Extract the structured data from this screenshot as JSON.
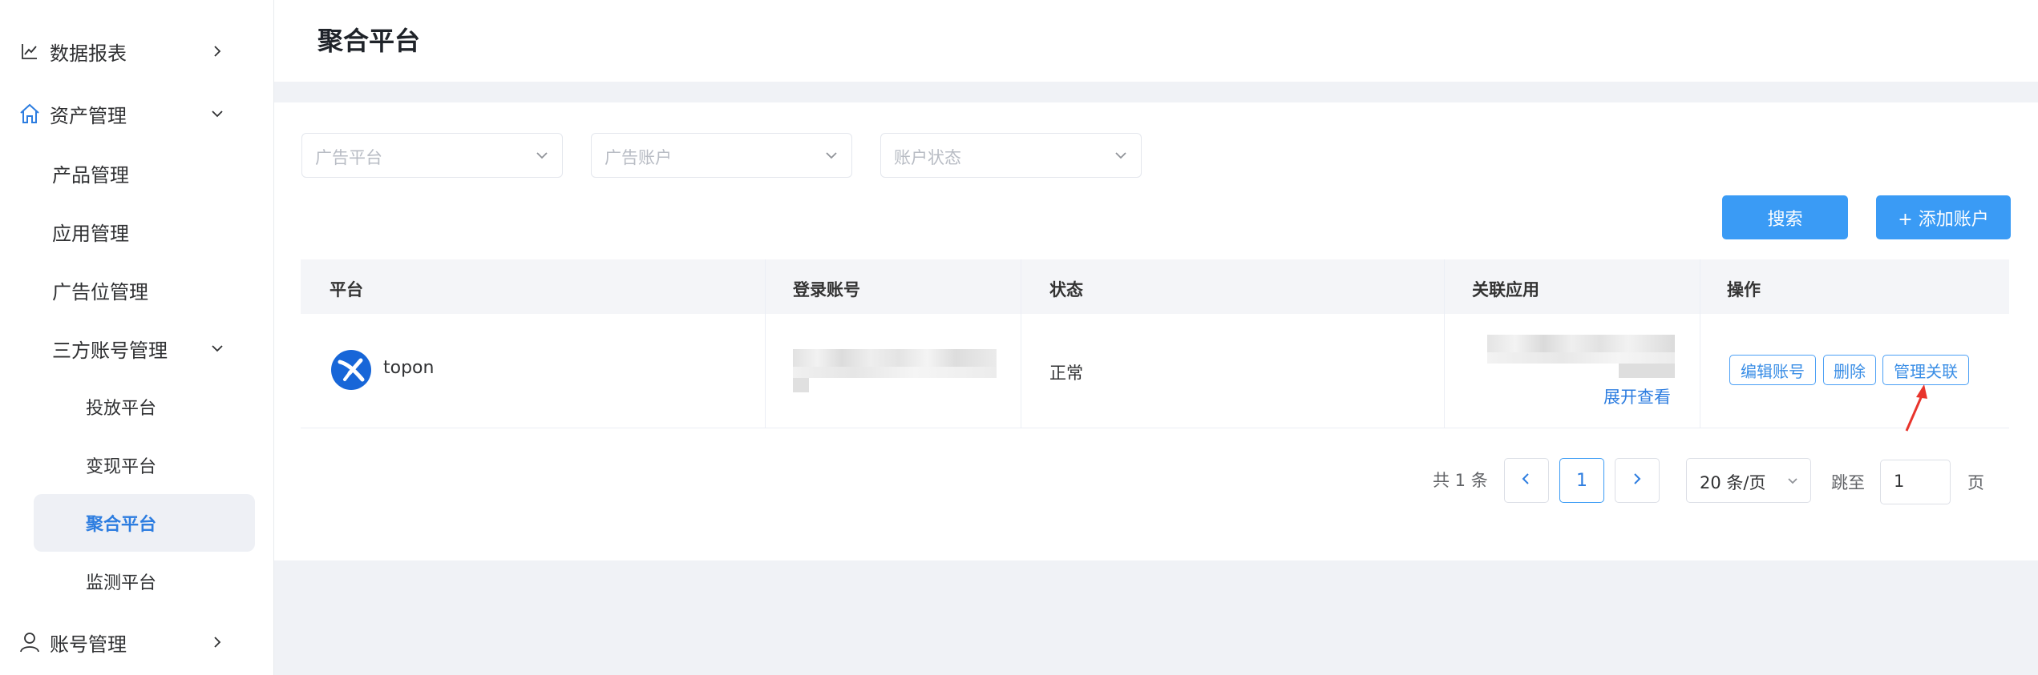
{
  "sidebar": {
    "items": [
      {
        "label": "数据报表",
        "icon": "line-chart-icon",
        "arrow": "chevron-right-icon"
      },
      {
        "label": "资产管理",
        "icon": "home-icon",
        "arrow": "chevron-down-icon"
      },
      {
        "label": "产品管理"
      },
      {
        "label": "应用管理"
      },
      {
        "label": "广告位管理"
      },
      {
        "label": "三方账号管理",
        "arrow": "chevron-down-icon"
      },
      {
        "label": "投放平台"
      },
      {
        "label": "变现平台"
      },
      {
        "label": "聚合平台",
        "active": true
      },
      {
        "label": "监测平台"
      },
      {
        "label": "账号管理",
        "icon": "user-icon",
        "arrow": "chevron-right-icon"
      }
    ]
  },
  "header": {
    "title": "聚合平台"
  },
  "filters": {
    "platform_placeholder": "广告平台",
    "account_placeholder": "广告账户",
    "status_placeholder": "账户状态"
  },
  "actions": {
    "search_label": "搜索",
    "add_label": "+ 添加账户"
  },
  "table": {
    "columns": [
      "平台",
      "登录账号",
      "状态",
      "关联应用",
      "操作"
    ],
    "rows": [
      {
        "platform": "topon",
        "status": "正常",
        "expand_label": "展开查看",
        "ops": [
          "编辑账号",
          "删除",
          "管理关联"
        ]
      }
    ]
  },
  "pagination": {
    "total_label": "共 1 条",
    "current_page": "1",
    "page_size_label": "20 条/页",
    "jump_label": "跳至",
    "jump_value": "1",
    "page_suffix": "页"
  },
  "colors": {
    "primary": "#3a9bf5",
    "active_text": "#2d7de0",
    "annotation_arrow": "#e8342c"
  }
}
